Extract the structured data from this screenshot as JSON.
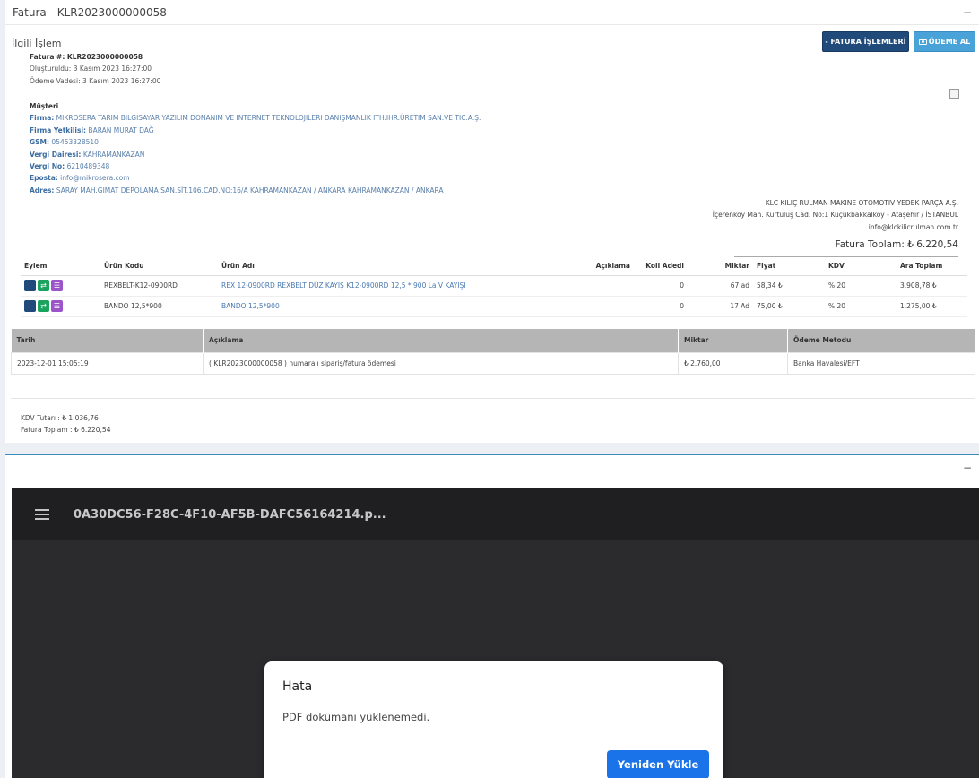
{
  "panel1": {
    "title": "Fatura - KLR2023000000058",
    "collapse": "−",
    "section_title": "İlgili İşlem",
    "buttons": {
      "ops": "- FATURA İŞLEMLERİ",
      "pay": "ÖDEME AL",
      "pay_icon": "cash-icon"
    },
    "invoice": {
      "number_label": "Fatura #: KLR2023000000058",
      "created": "Oluşturuldu: 3 Kasım 2023 16:27:00",
      "due": "Ödeme Vadesi: 3 Kasım 2023 16:27:00"
    },
    "customer": {
      "header": "Müşteri",
      "fields": [
        {
          "label": "Firma:",
          "value": "MIKROSERA TARIM BILGISAYAR YAZILIM DONANIM VE INTERNET TEKNOLOJILERI DANIŞMANLIK ITH.IHR.ÜRETIM SAN.VE TIC.A.Ş."
        },
        {
          "label": "Firma Yetkilisi:",
          "value": "BARAN MURAT DAĞ"
        },
        {
          "label": "GSM:",
          "value": "05453328510"
        },
        {
          "label": "Vergi Dairesi:",
          "value": "KAHRAMANKAZAN"
        },
        {
          "label": "Vergi No:",
          "value": "6210489348"
        },
        {
          "label": "Eposta:",
          "value": "info@mikrosera.com"
        },
        {
          "label": "Adres:",
          "value": "SARAY MAH.GIMAT DEPOLAMA SAN.SİT.106.CAD.NO:16/A KAHRAMANKAZAN / ANKARA KAHRAMANKAZAN / ANKARA"
        }
      ]
    },
    "company": {
      "name": "KLC KILIÇ RULMAN MAKINE OTOMOTIV YEDEK PARÇA A.Ş.",
      "address": "İçerenköy Mah. Kurtuluş Cad. No:1 Küçükbakkalköy - Ataşehir / İSTANBUL",
      "email": "info@klckilicrulman.com.tr"
    },
    "total": "Fatura Toplam:  ₺ 6.220,54",
    "items": {
      "headers": [
        "Eylem",
        "Ürün Kodu",
        "Ürün Adı",
        "Açıklama",
        "Koli Adedi",
        "Miktar",
        "Fiyat",
        "KDV",
        "Ara Toplam"
      ],
      "rows": [
        {
          "code": "REXBELT-K12-0900RD",
          "name": "REX 12-0900RD REXBELT DÜZ KAYIŞ K12-0900RD 12,5 * 900 La V KAYIŞI",
          "desc": "",
          "koli": "0",
          "qty": "67 ad",
          "price": "58,34 ₺",
          "kdv": "% 20",
          "subtotal": "3.908,78 ₺"
        },
        {
          "code": "BANDO 12,5*900",
          "name": "BANDO 12,5*900",
          "desc": "",
          "koli": "0",
          "qty": "17 Ad",
          "price": "75,00 ₺",
          "kdv": "% 20",
          "subtotal": "1.275,00 ₺"
        }
      ]
    },
    "payments": {
      "headers": [
        "Tarih",
        "Açıklama",
        "Miktar",
        "Ödeme Metodu"
      ],
      "rows": [
        {
          "date": "2023-12-01 15:05:19",
          "desc": "( KLR2023000000058 ) numaralı sipariş/fatura ödemesi",
          "amount": "₺ 2.760,00",
          "method": "Banka Havalesi/EFT"
        }
      ]
    },
    "summary": {
      "kdv": "KDV Tutarı : ₺  1.036,76",
      "total": "Fatura Toplam : ₺  6.220,54"
    }
  },
  "panel2": {
    "collapse": "−",
    "viewer": {
      "filename": "0A30DC56-F28C-4F10-AF5B-DAFC56164214.p...",
      "menu_icon": "hamburger-menu-icon",
      "dialog": {
        "title": "Hata",
        "message": "PDF dokümanı yüklenemedi.",
        "button": "Yeniden Yükle"
      }
    }
  }
}
